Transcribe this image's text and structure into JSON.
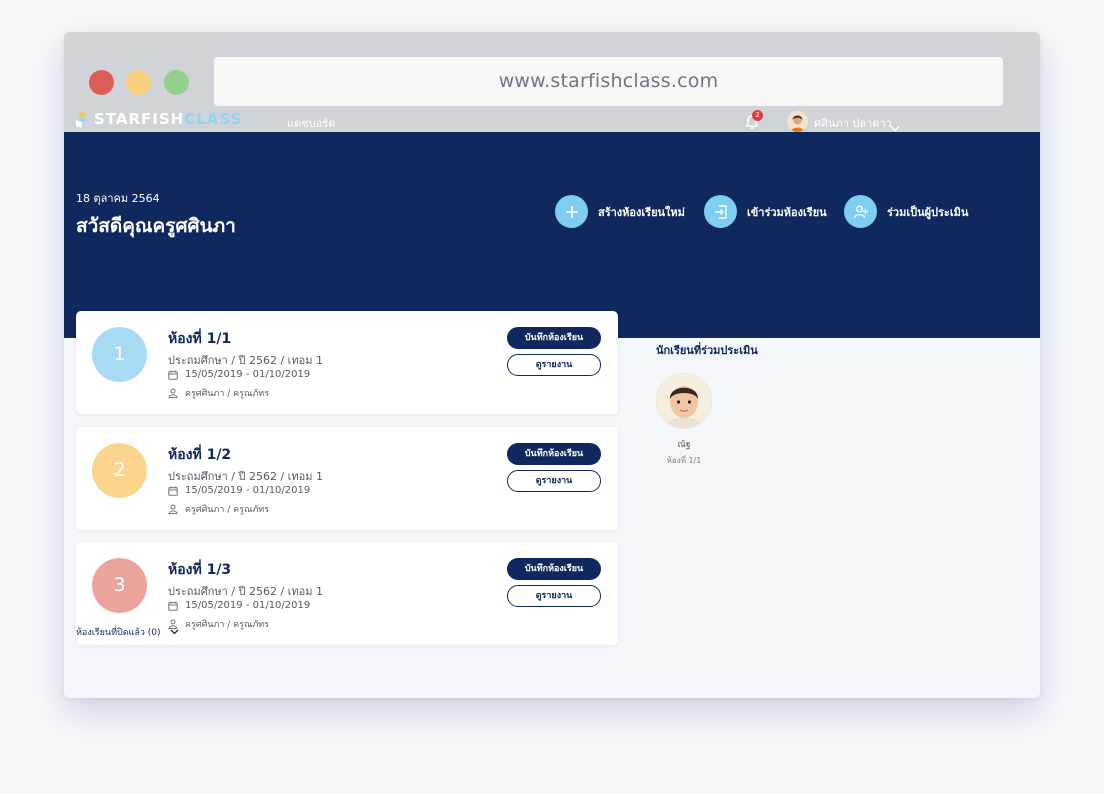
{
  "browser": {
    "url": "www.starfishclass.com"
  },
  "colors": {
    "navy": "#0f285e",
    "accent_blue": "#7fcdf1",
    "room_1": "#a6dbf3",
    "room_2": "#fbd48e",
    "room_3": "#eaa49c"
  },
  "header": {
    "logo_part1": "STARFISH",
    "logo_part2": "CLASS",
    "nav_dashboard": "แดชบอร์ด",
    "notification_count": "2",
    "user_name": "ศศินภา ปลาดาว"
  },
  "hero": {
    "date": "18 ตุลาคม 2564",
    "greeting": "สวัสดีคุณครูศศินภา",
    "actions": [
      {
        "label": "สร้างห้องเรียนใหม่",
        "icon": "plus-icon"
      },
      {
        "label": "เข้าร่วมห้องเรียน",
        "icon": "join-room-icon"
      },
      {
        "label": "ร่วมเป็นผู้ประเมิน",
        "icon": "add-user-icon"
      }
    ]
  },
  "classrooms": [
    {
      "number": "1",
      "title": "ห้องที่ 1/1",
      "level": "ประถมศึกษา / ปี 2562 / เทอม 1",
      "dates": "15/05/2019 - 01/10/2019",
      "teachers": "ครูศศินภา / ครูณภัทร",
      "record_label": "บันทึกห้องเรียน",
      "report_label": "ดูรายงาน"
    },
    {
      "number": "2",
      "title": "ห้องที่ 1/2",
      "level": "ประถมศึกษา / ปี 2562 / เทอม 1",
      "dates": "15/05/2019 - 01/10/2019",
      "teachers": "ครูศศินภา / ครูณภัทร",
      "record_label": "บันทึกห้องเรียน",
      "report_label": "ดูรายงาน"
    },
    {
      "number": "3",
      "title": "ห้องที่ 1/3",
      "level": "ประถมศึกษา / ปี 2562 / เทอม 1",
      "dates": "15/05/2019 - 01/10/2019",
      "teachers": "ครูศศินภา / ครูณภัทร",
      "record_label": "บันทึกห้องเรียน",
      "report_label": "ดูรายงาน"
    }
  ],
  "closed_rooms_label": "ห้องเรียนที่ปิดแล้ว (0)",
  "sidebar": {
    "title": "นักเรียนที่ร่วมประเมิน",
    "students": [
      {
        "name": "ณัฐ",
        "room": "ห้องที่ 1/1"
      }
    ]
  }
}
